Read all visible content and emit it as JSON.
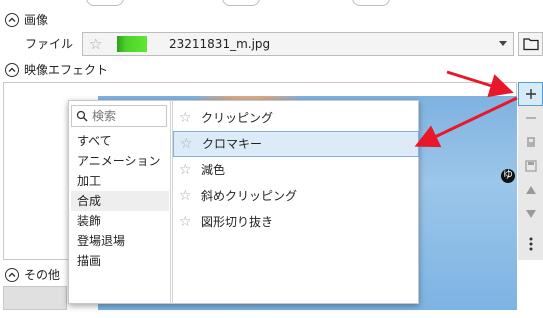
{
  "image_section": {
    "title": "画像",
    "file_label": "ファイル",
    "file_name": "23211831_m.jpg",
    "thumbnail_color": "#4fd12b"
  },
  "effects_section": {
    "title": "映像エフェクト"
  },
  "other_section": {
    "title": "その他"
  },
  "effect_picker": {
    "search_placeholder": "検索",
    "categories": [
      "すべて",
      "アニメーション",
      "加工",
      "合成",
      "装飾",
      "登場退場",
      "描画"
    ],
    "selected_category": "合成",
    "effects": [
      "クリッピング",
      "クロマキー",
      "減色",
      "斜めクリッピング",
      "図形切り抜き"
    ],
    "selected_effect": "クロマキー",
    "shortcut_badge": "ゆ"
  },
  "sidebar": {
    "buttons": [
      "+",
      "−",
      "copy",
      "save",
      "up",
      "down",
      "more"
    ]
  },
  "colors": {
    "accent": "#5b9bd5",
    "arrow": "#e8182b",
    "selection": "#dcebf7"
  },
  "icons": {
    "add": "plus-icon",
    "remove": "minus-icon",
    "copy": "copy-icon",
    "save": "save-icon",
    "up": "triangle-up-icon",
    "down": "triangle-down-icon",
    "more": "more-vertical-icon",
    "folder": "folder-icon",
    "star": "star-icon",
    "search": "search-icon",
    "collapse": "chevron-up-icon"
  }
}
